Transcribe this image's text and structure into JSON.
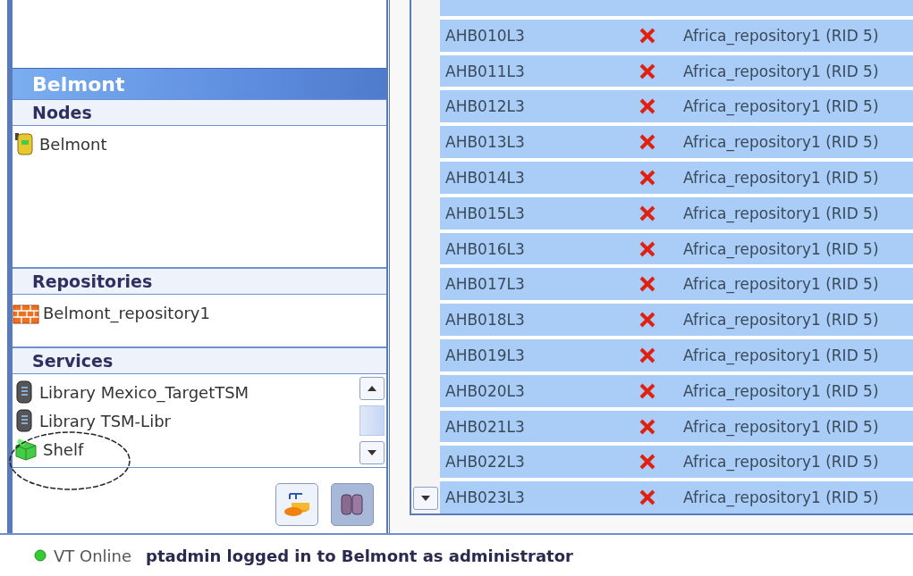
{
  "panel": {
    "title": "Belmont",
    "sections": [
      {
        "heading": "Nodes",
        "scrollable": false,
        "items": [
          {
            "label": "Belmont",
            "kind": "node"
          }
        ]
      },
      {
        "heading": "Repositories",
        "scrollable": false,
        "items": [
          {
            "label": "Belmont_repository1",
            "kind": "repository"
          }
        ]
      },
      {
        "heading": "Services",
        "scrollable": true,
        "items": [
          {
            "label": "Library Mexico_TargetTSM",
            "kind": "library"
          },
          {
            "label": "Library TSM-Libr",
            "kind": "library"
          },
          {
            "label": "Shelf",
            "kind": "shelf"
          }
        ]
      }
    ],
    "tool_buttons": [
      {
        "kind": "repository",
        "selected": false
      },
      {
        "kind": "library",
        "selected": true
      }
    ]
  },
  "volumes": {
    "rows": [
      {
        "volume": "AHB010L3",
        "kind": "error",
        "repository": "Africa_repository1 (RID 5)",
        "selected": true
      },
      {
        "volume": "AHB011L3",
        "kind": "error",
        "repository": "Africa_repository1 (RID 5)",
        "selected": true
      },
      {
        "volume": "AHB012L3",
        "kind": "error",
        "repository": "Africa_repository1 (RID 5)",
        "selected": true
      },
      {
        "volume": "AHB013L3",
        "kind": "error",
        "repository": "Africa_repository1 (RID 5)",
        "selected": true
      },
      {
        "volume": "AHB014L3",
        "kind": "error",
        "repository": "Africa_repository1 (RID 5)",
        "selected": true
      },
      {
        "volume": "AHB015L3",
        "kind": "error",
        "repository": "Africa_repository1 (RID 5)",
        "selected": true
      },
      {
        "volume": "AHB016L3",
        "kind": "error",
        "repository": "Africa_repository1 (RID 5)",
        "selected": true
      },
      {
        "volume": "AHB017L3",
        "kind": "error",
        "repository": "Africa_repository1 (RID 5)",
        "selected": true
      },
      {
        "volume": "AHB018L3",
        "kind": "error",
        "repository": "Africa_repository1 (RID 5)",
        "selected": true
      },
      {
        "volume": "AHB019L3",
        "kind": "error",
        "repository": "Africa_repository1 (RID 5)",
        "selected": true
      },
      {
        "volume": "AHB020L3",
        "kind": "error",
        "repository": "Africa_repository1 (RID 5)",
        "selected": true
      },
      {
        "volume": "AHB021L3",
        "kind": "error",
        "repository": "Africa_repository1 (RID 5)",
        "selected": true
      },
      {
        "volume": "AHB022L3",
        "kind": "error",
        "repository": "Africa_repository1 (RID 5)",
        "selected": true
      },
      {
        "volume": "AHB023L3",
        "kind": "error",
        "repository": "Africa_repository1 (RID 5)",
        "selected": true
      }
    ]
  },
  "status_bar": {
    "connection": "VT Online",
    "online": true,
    "message": "ptadmin logged in to Belmont as administrator"
  }
}
